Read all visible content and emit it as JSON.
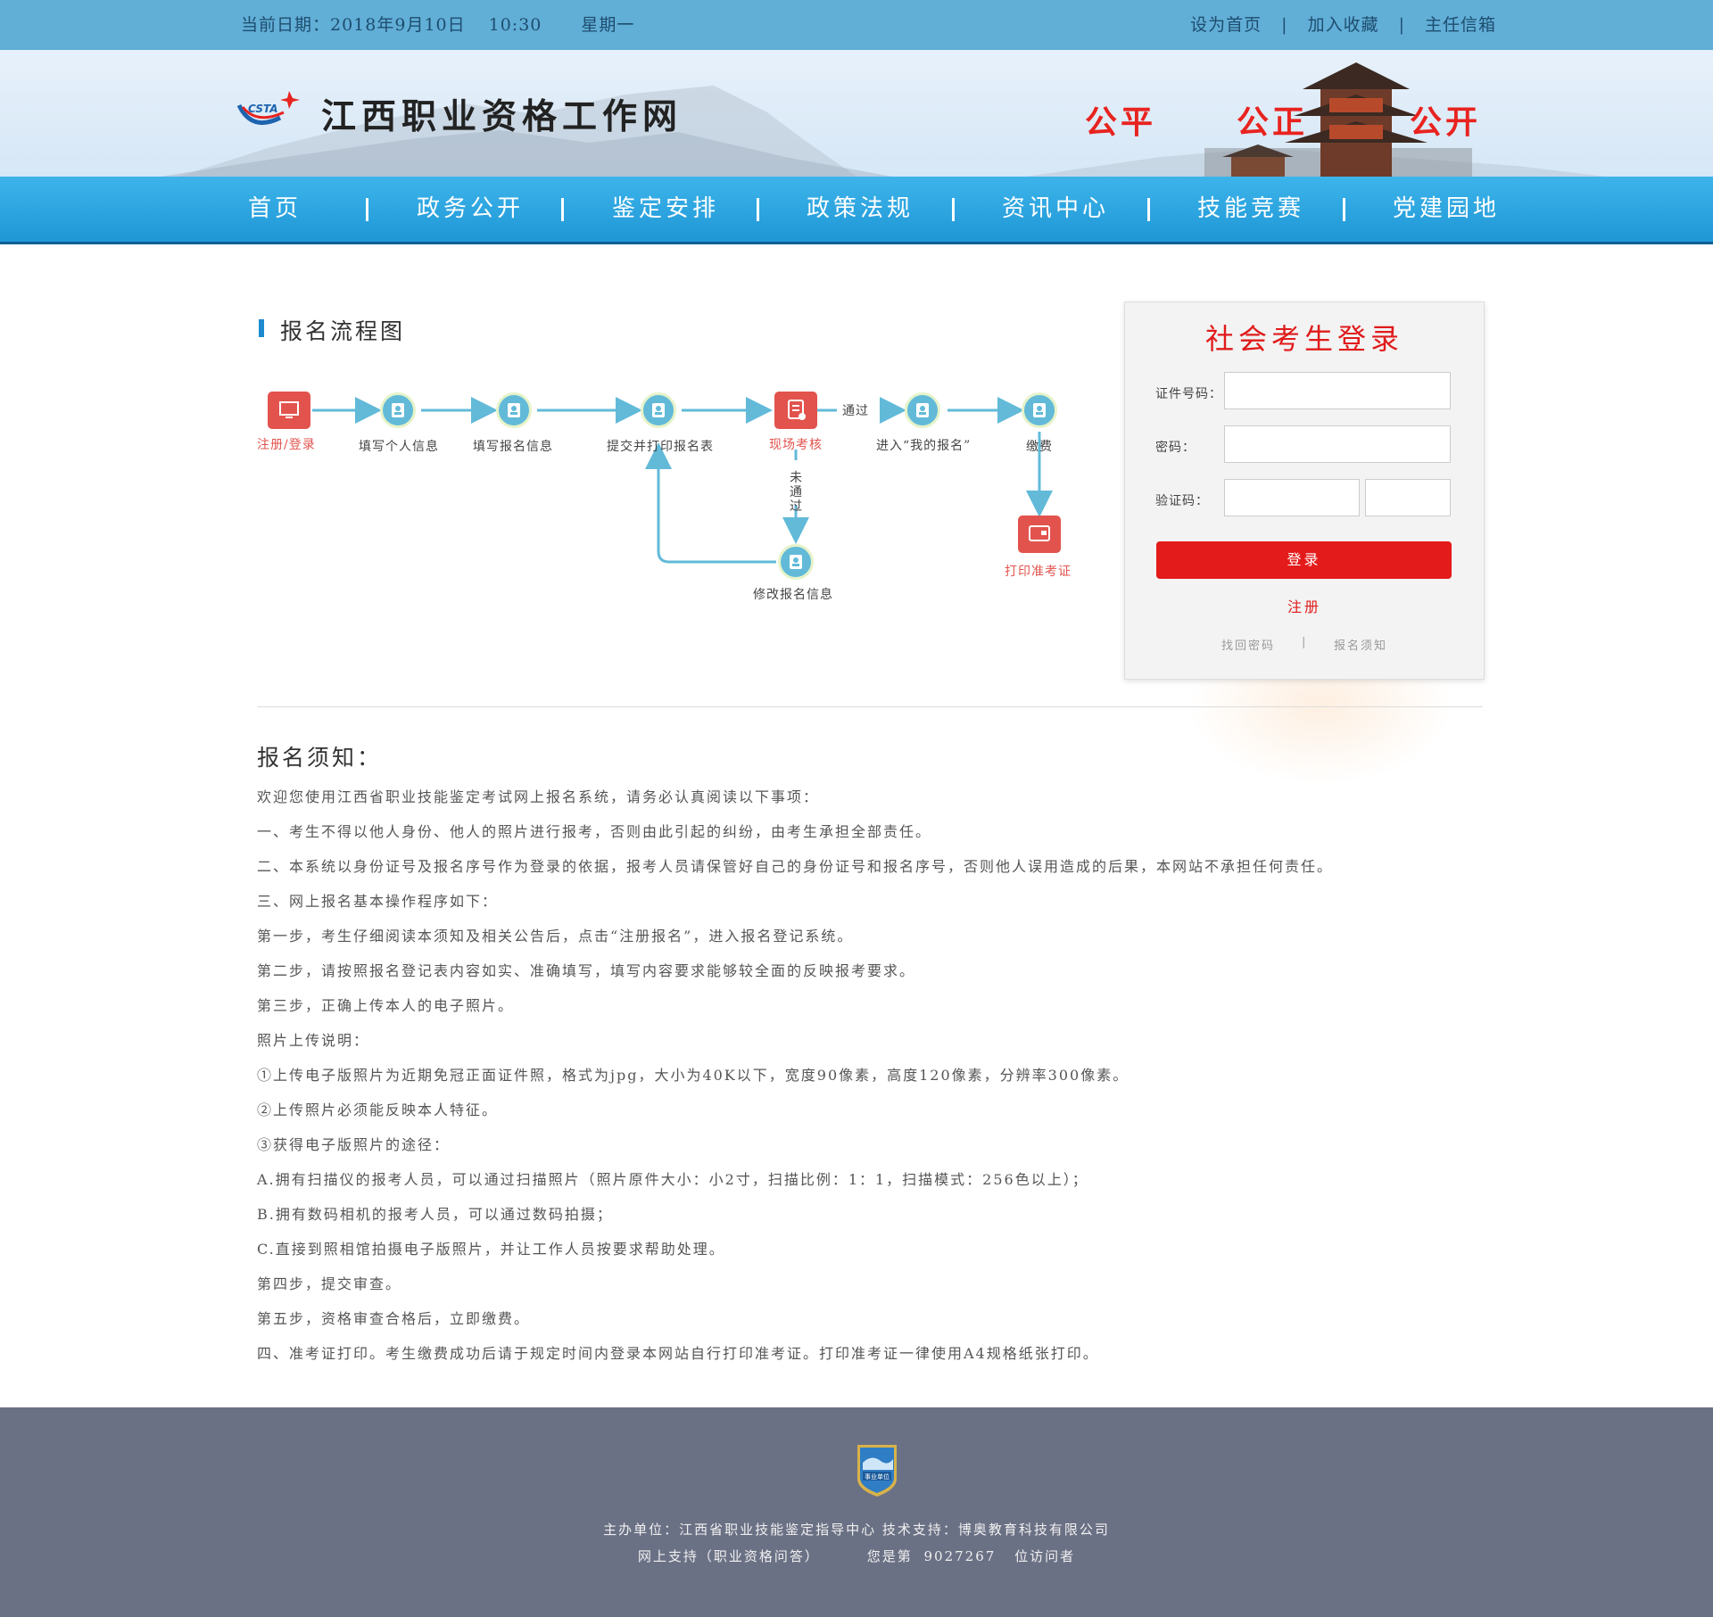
{
  "topbar": {
    "date_label": "当前日期：2018年9月10日",
    "time": "10:30",
    "weekday": "星期一",
    "links": [
      "设为首页",
      "加入收藏",
      "主任信箱"
    ],
    "separator": "|"
  },
  "banner": {
    "logo_text": "CSTA",
    "site_name": "江西职业资格工作网",
    "slogans": [
      "公平",
      "公正",
      "公开"
    ]
  },
  "nav": {
    "items": [
      "首页",
      "政务公开",
      "鉴定安排",
      "政策法规",
      "资讯中心",
      "技能竞赛",
      "党建园地"
    ]
  },
  "flow": {
    "title": "报名流程图",
    "steps": {
      "register": "注册/登录",
      "personal_info": "填写个人信息",
      "signup_info": "填写报名信息",
      "submit_print": "提交并打印报名表",
      "onsite_review": "现场考核",
      "my_signup": "进入“我的报名”",
      "pay": "缴费",
      "print_ticket": "打印准考证",
      "modify": "修改报名信息"
    },
    "pass_label": "通过",
    "fail_label": [
      "未",
      "通",
      "过"
    ]
  },
  "login": {
    "title": "社会考生登录",
    "id_label": "证件号码：",
    "password_label": "密码：",
    "captcha_label": "验证码：",
    "id_value": "",
    "password_value": "",
    "captcha_value": "",
    "submit_label": "登录",
    "register_label": "注册",
    "forgot_label": "找回密码",
    "notice_label": "报名须知",
    "separator": "|"
  },
  "notice": {
    "title": "报名须知：",
    "lines": [
      "欢迎您使用江西省职业技能鉴定考试网上报名系统，请务必认真阅读以下事项：",
      "一、考生不得以他人身份、他人的照片进行报考，否则由此引起的纠纷，由考生承担全部责任。",
      "二、本系统以身份证号及报名序号作为登录的依据，报考人员请保管好自己的身份证号和报名序号，否则他人误用造成的后果，本网站不承担任何责任。",
      "三、网上报名基本操作程序如下：",
      "第一步，考生仔细阅读本须知及相关公告后，点击“注册报名”，进入报名登记系统。",
      "第二步，请按照报名登记表内容如实、准确填写，填写内容要求能够较全面的反映报考要求。",
      "第三步，正确上传本人的电子照片。",
      "照片上传说明：",
      "①上传电子版照片为近期免冠正面证件照，格式为jpg，大小为40K以下，宽度90像素，高度120像素，分辨率300像素。",
      "②上传照片必须能反映本人特征。",
      "③获得电子版照片的途径：",
      "A.拥有扫描仪的报考人员，可以通过扫描照片（照片原件大小：小2寸，扫描比例：1：1，扫描模式：256色以上）；",
      "B.拥有数码相机的报考人员，可以通过数码拍摄；",
      "C.直接到照相馆拍摄电子版照片，并让工作人员按要求帮助处理。",
      "第四步，提交审查。",
      "第五步，资格审查合格后，立即缴费。",
      "四、准考证打印。考生缴费成功后请于规定时间内登录本网站自行打印准考证。打印准考证一律使用A4规格纸张打印。"
    ]
  },
  "footer": {
    "badge_text": "事业单位",
    "line1": "主办单位：江西省职业技能鉴定指导中心  技术支持：博奥教育科技有限公司",
    "support": "网上支持（职业资格问答）",
    "visitors_prefix": "您是第",
    "visitors_count": "9027267",
    "visitors_suffix": "位访问者"
  },
  "colors": {
    "topbar": "#61aed7",
    "nav": "#2aa5e0",
    "accent_red": "#e41b1b",
    "node_blue": "#62bad8",
    "footer": "#6b7185"
  }
}
